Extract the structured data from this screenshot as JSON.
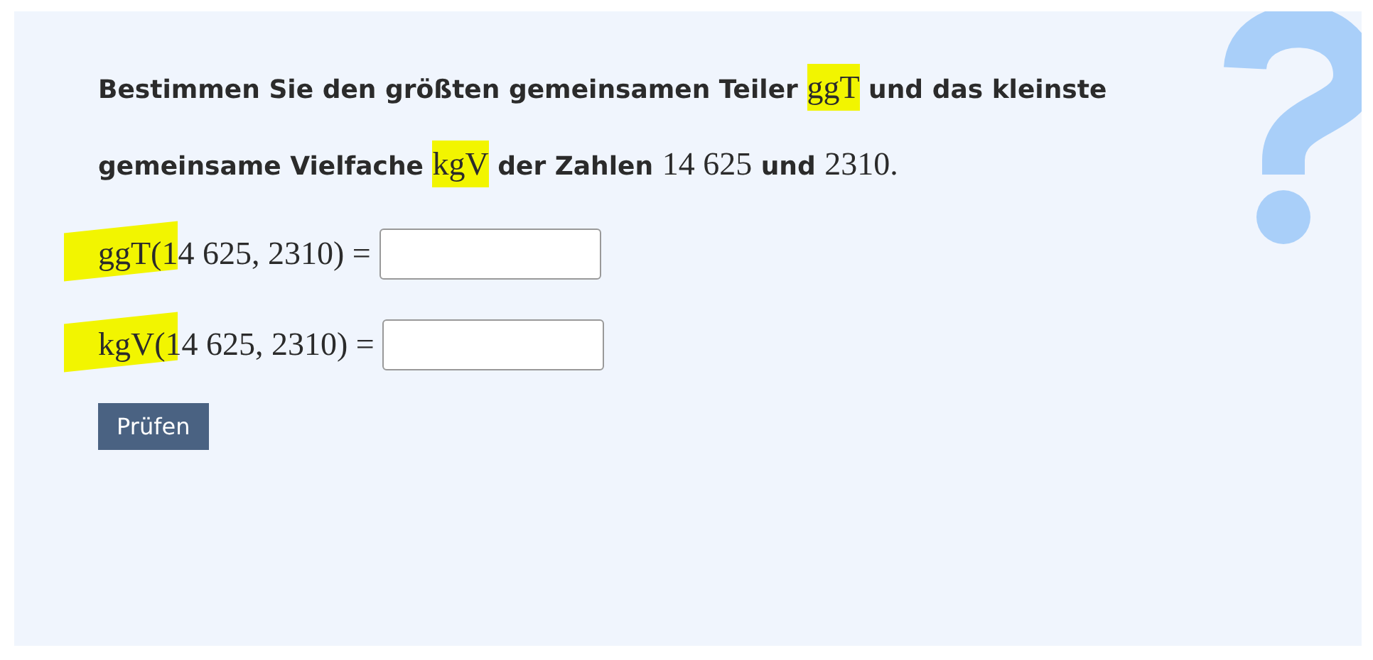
{
  "question": [
    {
      "kind": "text",
      "text": "Bestimmen Sie den größten gemeinsamen Teiler ",
      "highlighted": false
    },
    {
      "kind": "math",
      "text": "ggT",
      "highlighted": true
    },
    {
      "kind": "text",
      "text": " und das kleinste gemeinsame Vielfache ",
      "highlighted": false
    },
    {
      "kind": "math",
      "text": "kgV",
      "highlighted": true
    },
    {
      "kind": "text",
      "text": " der Zahlen ",
      "highlighted": false
    },
    {
      "kind": "math",
      "text": "14 625",
      "highlighted": false
    },
    {
      "kind": "text",
      "text": " und ",
      "highlighted": false
    },
    {
      "kind": "math",
      "text": "2310",
      "highlighted": false
    },
    {
      "kind": "math",
      "text": ".",
      "highlighted": false
    }
  ],
  "equations": [
    {
      "label": "ggT(14 625, 2310) =",
      "highlighted": true
    },
    {
      "label": "kgV(14 625, 2310) =",
      "highlighted": true
    }
  ],
  "check_button": "Prüfen"
}
